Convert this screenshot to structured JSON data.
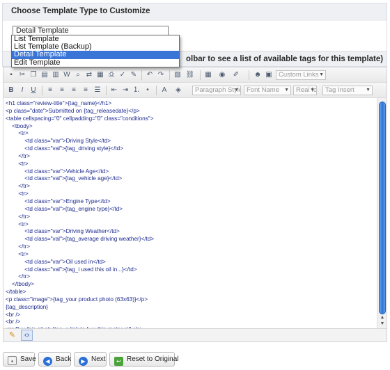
{
  "template_section": {
    "title": "Choose Template Type to Customize",
    "selected": "Detail Template",
    "options": [
      "List Template",
      "List Template (Backup)",
      "Detail Template",
      "Edit Template"
    ],
    "highlighted_index": 2
  },
  "editor": {
    "header_text": "olbar to see a list of available tags for this template)",
    "toolbar": {
      "custom_links": "Custom Links",
      "paragraph_style": "Paragraph Style",
      "font_name": "Font Name",
      "real_font": "Real fo",
      "tag_insert": "Tag Insert"
    },
    "code_lines": [
      "<h1 class=\"review-title\">{tag_name}</h1>",
      "<p class=\"date\">Submitted on {tag_releasedate}</p>",
      "<table cellspacing=\"0\" cellpadding=\"0\" class=\"conditions\">",
      "    <tbody>",
      "        <tr>",
      "            <td class=\"var\">Driving Style</td>",
      "            <td class=\"val\">{tag_driving style}</td>",
      "        </tr>",
      "        <tr>",
      "            <td class=\"var\">Vehicle Age</td>",
      "            <td class=\"val\">{tag_vehicle age}</td>",
      "        </tr>",
      "        <tr>",
      "            <td class=\"var\">Engine Type</td>",
      "            <td class=\"val\">{tag_engine type}</td>",
      "        </tr>",
      "        <tr>",
      "            <td class=\"var\">Driving Weather</td>",
      "            <td class=\"val\">{tag_average driving weather}</td>",
      "        </tr>",
      "        <tr>",
      "            <td class=\"var\">Oil used in</td>",
      "            <td class=\"val\">{tag_i used this oil in...}</td>",
      "        </tr>",
      "    </tbody>",
      "</table>",
      "<p class=\"image\">{tag_your product photo (63x63)}</p>",
      "{tag_description}",
      "<br />",
      "<br />",
      "<p>Buy this oil at: {tag_a link to buy this motor oil}</p>"
    ]
  },
  "buttons": {
    "save": "Save",
    "back": "Back",
    "next": "Next",
    "reset": "Reset to Original"
  },
  "colors": {
    "code_text": "#1d2b8f",
    "selection": "#3875d7",
    "scroll_thumb": "#2f73d6"
  }
}
